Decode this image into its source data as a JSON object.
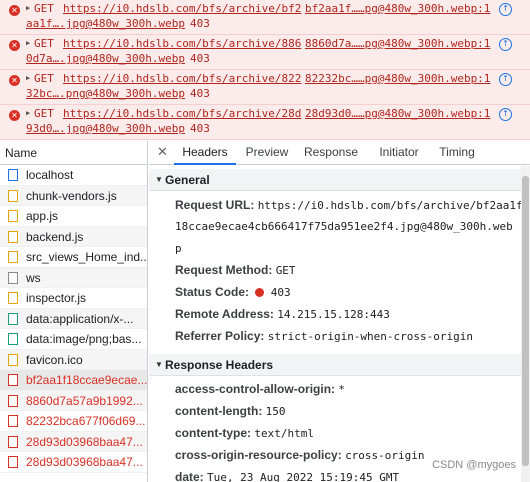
{
  "console_errors": [
    {
      "method": "GET",
      "url_line1": "https://i0.hdslb.com/bfs/archive/bf2",
      "url_line2": "aa1f….jpg@480w_300h.webp",
      "status": "403",
      "source": "bf2aa1f……pg@480w_300h.webp:1"
    },
    {
      "method": "GET",
      "url_line1": "https://i0.hdslb.com/bfs/archive/886",
      "url_line2": "0d7a….jpg@480w_300h.webp",
      "status": "403",
      "source": "8860d7a……pg@480w_300h.webp:1"
    },
    {
      "method": "GET",
      "url_line1": "https://i0.hdslb.com/bfs/archive/822",
      "url_line2": "32bc….png@480w_300h.webp",
      "status": "403",
      "source": "82232bc……pg@480w_300h.webp:1"
    },
    {
      "method": "GET",
      "url_line1": "https://i0.hdslb.com/bfs/archive/28d",
      "url_line2": "93d0….jpg@480w_300h.webp",
      "status": "403",
      "source": "28d93d0……pg@480w_300h.webp:1"
    }
  ],
  "requests": {
    "header": "Name",
    "items": [
      {
        "name": "localhost",
        "icon": "doc"
      },
      {
        "name": "chunk-vendors.js",
        "icon": "js"
      },
      {
        "name": "app.js",
        "icon": "js"
      },
      {
        "name": "backend.js",
        "icon": "js"
      },
      {
        "name": "src_views_Home_ind...",
        "icon": "js"
      },
      {
        "name": "ws",
        "icon": "plain"
      },
      {
        "name": "inspector.js",
        "icon": "js"
      },
      {
        "name": "data:application/x-...",
        "icon": "img"
      },
      {
        "name": "data:image/png;bas...",
        "icon": "img"
      },
      {
        "name": "favicon.ico",
        "icon": "js"
      },
      {
        "name": "bf2aa1f18ccae9ecae...",
        "icon": "err",
        "error": true,
        "selected": true
      },
      {
        "name": "8860d7a57a9b1992...",
        "icon": "err",
        "error": true
      },
      {
        "name": "82232bca677f06d69...",
        "icon": "err",
        "error": true
      },
      {
        "name": "28d93d03968baa47...",
        "icon": "err",
        "error": true
      },
      {
        "name": "28d93d03968baa47...",
        "icon": "err",
        "error": true
      }
    ]
  },
  "tabs": {
    "close": "✕",
    "items": [
      "Headers",
      "Preview",
      "Response",
      "Initiator",
      "Timing"
    ],
    "active": "Headers"
  },
  "general": {
    "title": "General",
    "request_url_label": "Request URL:",
    "request_url_line1": "https://i0.hdslb.com/bfs/archive/bf2aa1f",
    "request_url_line2": "18ccae9ecae4cb666417f75da951ee2f4.jpg@480w_300h.web",
    "request_url_line3": "p",
    "request_method_label": "Request Method:",
    "request_method": "GET",
    "status_code_label": "Status Code:",
    "status_code": "403",
    "remote_address_label": "Remote Address:",
    "remote_address": "14.215.15.128:443",
    "referrer_policy_label": "Referrer Policy:",
    "referrer_policy": "strict-origin-when-cross-origin"
  },
  "response_headers": {
    "title": "Response Headers",
    "items": [
      {
        "name": "access-control-allow-origin:",
        "value": "*"
      },
      {
        "name": "content-length:",
        "value": "150"
      },
      {
        "name": "content-type:",
        "value": "text/html"
      },
      {
        "name": "cross-origin-resource-policy:",
        "value": "cross-origin"
      },
      {
        "name": "date:",
        "value": "Tue, 23 Aug 2022 15:19:45 GMT"
      }
    ]
  },
  "watermark": "CSDN @mygoes",
  "colors": {
    "error": "#d93025",
    "accent": "#1a73e8",
    "error_bg": "#fcebeb"
  }
}
